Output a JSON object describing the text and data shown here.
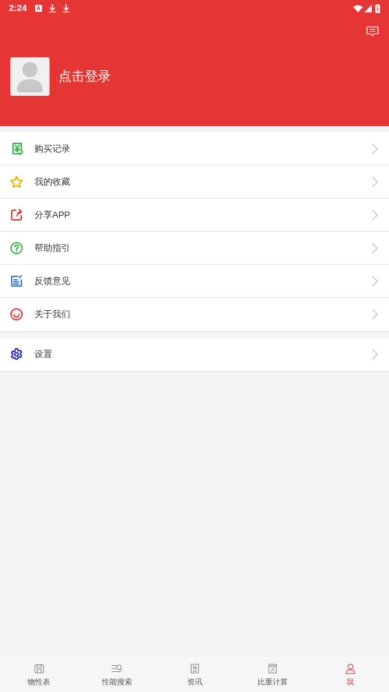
{
  "status_bar": {
    "time": "2:24"
  },
  "profile": {
    "login_text": "点击登录"
  },
  "menu_groups": [
    {
      "items": [
        {
          "label": "购买记录",
          "kind": "receipt",
          "color": "#3cb44b"
        },
        {
          "label": "我的收藏",
          "kind": "star",
          "color": "#f0b400"
        },
        {
          "label": "分享APP",
          "kind": "share",
          "color": "#e53535"
        },
        {
          "label": "帮助指引",
          "kind": "help",
          "color": "#3cb44b"
        },
        {
          "label": "反馈意见",
          "kind": "feedback",
          "color": "#3a7bd5"
        },
        {
          "label": "关于我们",
          "kind": "smile",
          "color": "#e53535"
        }
      ]
    },
    {
      "items": [
        {
          "label": "设置",
          "kind": "gear",
          "color": "#3030b0"
        }
      ]
    }
  ],
  "bottom_nav": [
    {
      "label": "物性表",
      "kind": "table",
      "selected": false
    },
    {
      "label": "性能搜索",
      "kind": "search",
      "selected": false
    },
    {
      "label": "资讯",
      "kind": "news",
      "selected": false
    },
    {
      "label": "比重计算",
      "kind": "calc",
      "selected": false
    },
    {
      "label": "我",
      "kind": "user",
      "selected": true
    }
  ]
}
